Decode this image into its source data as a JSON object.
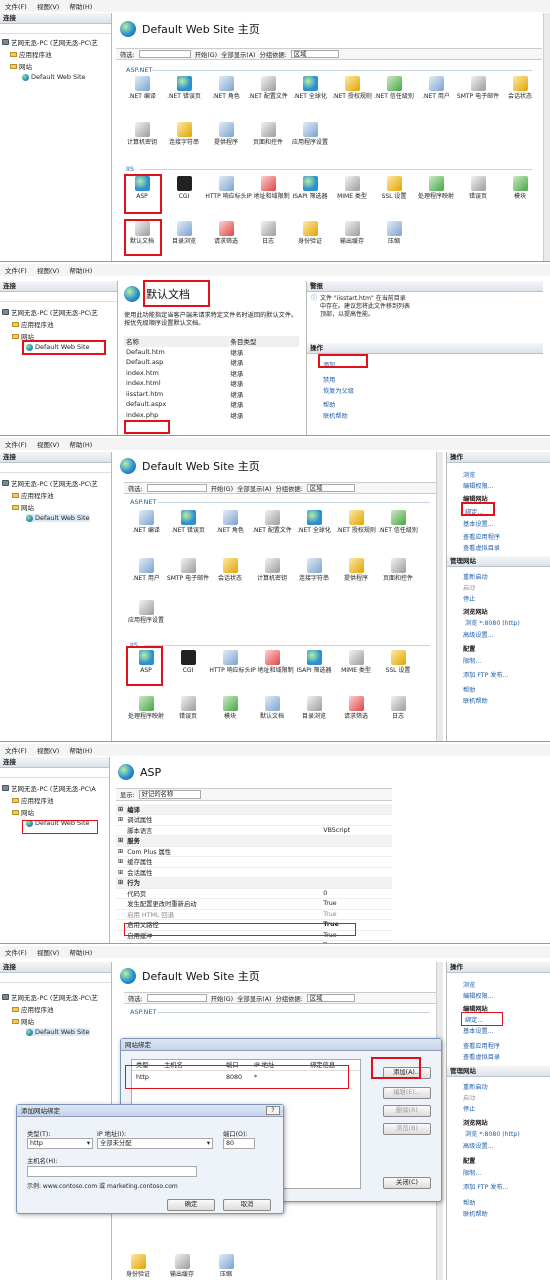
{
  "menu": {
    "file": "文件(F)",
    "view": "视图(V)",
    "help": "帮助(H)"
  },
  "conn": {
    "title": "连接",
    "server": "艺网无丞-PC (艺网无丞-PC\\艺",
    "apppools": "应用程序池",
    "sites": "网站",
    "site": "Default Web Site",
    "server_short": "艺网无丞-PC (艺网无丞-PC\\A"
  },
  "s1": {
    "title": "Default Web Site 主页",
    "filter_label": "筛选:",
    "go": "开始(G)",
    "show_all": "全部显示(A)",
    "group_by": "分组依据:",
    "group_value": "区域",
    "aspnet": "ASP.NET",
    "iis": "IIS",
    "aspnet_icons": [
      ".NET 编译",
      ".NET 错误页",
      ".NET 角色",
      ".NET 配置文件",
      ".NET 全球化",
      ".NET 授权规则",
      ".NET 信任级别",
      ".NET 用户",
      "SMTP 电子邮件",
      "会话状态"
    ],
    "aspnet_icons2": [
      "计算机密钥",
      "连接字符串",
      "提供程序",
      "页面和控件",
      "应用程序设置"
    ],
    "iis_icons": [
      "ASP",
      "CGI",
      "HTTP 响应标头",
      "IP 地址和域限制",
      "ISAPI 筛选器",
      "MIME 类型",
      "SSL 设置",
      "处理程序映射",
      "错误页",
      "模块"
    ],
    "iis_icons2": [
      "默认文档",
      "目录浏览",
      "请求筛选",
      "日志",
      "身份验证",
      "输出缓存",
      "压缩"
    ]
  },
  "s2": {
    "title": "默认文档",
    "desc": "使用此功能指定当客户端未请求特定文件名时返回的默认文件。按优先级顺序设置默认文档。",
    "col_name": "名称",
    "col_type": "条目类型",
    "rows": [
      {
        "name": "Default.htm",
        "type": "继承"
      },
      {
        "name": "Default.asp",
        "type": "继承"
      },
      {
        "name": "index.htm",
        "type": "继承"
      },
      {
        "name": "index.html",
        "type": "继承"
      },
      {
        "name": "iisstart.htm",
        "type": "继承"
      },
      {
        "name": "default.aspx",
        "type": "继承"
      },
      {
        "name": "index.php",
        "type": "继承"
      }
    ],
    "alerts_title": "警报",
    "alert_text": "文件 \"iisstart.htm\" 在当前目录中存在。建议您将此文件移到列表顶部，以提高性能。",
    "actions_title": "操作",
    "add": "添加...",
    "disable": "禁用",
    "revert": "恢复为父级",
    "help": "帮助",
    "online_help": "联机帮助"
  },
  "s3": {
    "aspnet_icons": [
      ".NET 编译",
      ".NET 错误页",
      ".NET 角色",
      ".NET 配置文件",
      ".NET 全球化",
      ".NET 授权规则",
      ".NET 信任级别"
    ],
    "aspnet_icons2": [
      ".NET 用户",
      "SMTP 电子邮件",
      "会话状态",
      "计算机密钥",
      "连接字符串",
      "提供程序",
      "页面和控件"
    ],
    "aspnet_icons3": [
      "应用程序设置"
    ],
    "iis_icons": [
      "ASP",
      "CGI",
      "HTTP 响应标头",
      "IP 地址和域限制",
      "ISAPI 筛选器",
      "MIME 类型",
      "SSL 设置"
    ],
    "iis_icons2": [
      "处理程序映射",
      "错误页",
      "模块",
      "默认文档",
      "目录浏览",
      "请求筛选",
      "日志"
    ],
    "actions": {
      "title": "操作",
      "browse": "浏览",
      "edit_perm": "编辑权限...",
      "edit_site": "编辑网站",
      "bindings": "绑定...",
      "basic": "基本设置...",
      "view_apps": "查看应用程序",
      "view_vdirs": "查看虚拟目录",
      "manage": "管理网站",
      "restart": "重新启动",
      "start": "启动",
      "stop": "停止",
      "browse_site": "浏览网站",
      "browse_8080": "浏览 *:8080 (http)",
      "advanced": "高级设置...",
      "config": "配置",
      "limits": "限制...",
      "add_ftp": "添加 FTP 发布...",
      "help": "帮助",
      "online_help": "联机帮助"
    }
  },
  "s4": {
    "title": "ASP",
    "show_label": "显示:",
    "show_value": "好记的名称",
    "props": [
      {
        "g": true,
        "name": "编译",
        "value": ""
      },
      {
        "g": false,
        "name": "调试属性",
        "value": "",
        "plus": true
      },
      {
        "g": false,
        "name": "脚本语言",
        "value": "VBScript"
      },
      {
        "g": true,
        "name": "服务",
        "value": ""
      },
      {
        "g": false,
        "name": "Com Plus 属性",
        "value": "",
        "plus": true
      },
      {
        "g": false,
        "name": "缓存属性",
        "value": "",
        "plus": true
      },
      {
        "g": false,
        "name": "会话属性",
        "value": "",
        "plus": true
      },
      {
        "g": true,
        "name": "行为",
        "value": ""
      },
      {
        "g": false,
        "name": "代码页",
        "value": "0"
      },
      {
        "g": false,
        "name": "发生配置更改时重新启动",
        "value": "True"
      },
      {
        "g": false,
        "name": "启用 HTML 回退",
        "value": "True"
      },
      {
        "g": false,
        "name": "启用父路径",
        "value": "True",
        "hl": true
      },
      {
        "g": false,
        "name": "启用缓冲",
        "value": "True"
      },
      {
        "g": false,
        "name": "启用块编码",
        "value": "True"
      }
    ]
  },
  "s5": {
    "bind_dlg_title": "网站绑定",
    "cols": [
      "类型",
      "主机名",
      "端口",
      "IP 地址",
      "绑定信息"
    ],
    "row": {
      "type": "http",
      "host": "",
      "port": "8080",
      "ip": "*"
    },
    "add": "添加(A)...",
    "edit": "编辑(E)...",
    "remove": "删除(R)",
    "browse": "浏览(B)",
    "close": "关闭(C)",
    "add_dlg_title": "添加网站绑定",
    "type_label": "类型(T):",
    "type_value": "http",
    "ip_label": "IP 地址(I):",
    "ip_value": "全部未分配",
    "port_label": "端口(O):",
    "port_value": "80",
    "host_label": "主机名(H):",
    "example": "示例: www.contoso.com 或 marketing.contoso.com",
    "ok": "确定",
    "cancel": "取消",
    "bottom_icons": [
      "身份验证",
      "输出缓存",
      "压缩"
    ]
  }
}
